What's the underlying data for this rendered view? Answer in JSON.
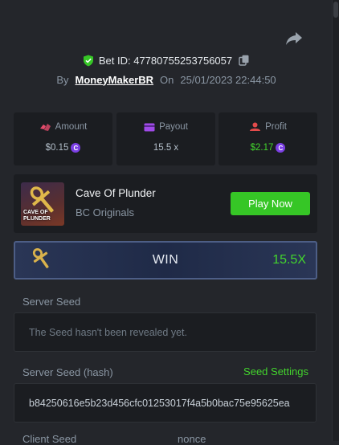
{
  "header": {
    "bet_id": "Bet ID: 47780755253756057",
    "by_label": "By",
    "username": "MoneyMakerBR",
    "on_label": "On",
    "datetime": "25/01/2023 22:44:50"
  },
  "stats": {
    "amount": {
      "label": "Amount",
      "value": "$0.15"
    },
    "payout": {
      "label": "Payout",
      "value": "15.5 x"
    },
    "profit": {
      "label": "Profit",
      "value": "$2.17"
    }
  },
  "coin_symbol": "C",
  "game": {
    "thumb_title_line1": "CAVE OF",
    "thumb_title_line2": "PLUNDER",
    "name": "Cave Of Plunder",
    "provider": "BC Originals",
    "play_label": "Play Now"
  },
  "result": {
    "label": "WIN",
    "multiplier": "15.5X"
  },
  "server_seed": {
    "label": "Server Seed",
    "value": "The Seed hasn't been revealed yet."
  },
  "server_seed_hash": {
    "label": "Server Seed (hash)",
    "settings_label": "Seed Settings",
    "value": "b84250616e5b23d456cfc01253017f4a5b0bac75e95625ea"
  },
  "footer_labels": {
    "client_seed": "Client Seed",
    "nonce": "nonce"
  },
  "colors": {
    "accent_green": "#36c626",
    "profit_green": "#43d52d",
    "coin_purple": "#7b3fe4",
    "background": "#24262b",
    "card": "#1b1d21"
  },
  "icons": [
    "share-icon",
    "shield-check-icon",
    "copy-icon",
    "amount-icon",
    "payout-icon",
    "profit-icon",
    "coin-icon",
    "key-ankh-icon"
  ]
}
